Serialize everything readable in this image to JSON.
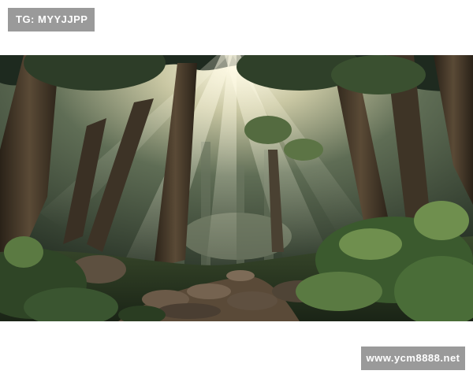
{
  "watermarks": {
    "top_left": "TG: MYYJJPP",
    "bottom_right": "www.ycm8888.net"
  },
  "scene": {
    "subject": "forest-path-with-sunbeams",
    "colors": {
      "canopy_dark": "#1e2a1f",
      "foliage": "#3d5a32",
      "fern": "#6f8f4e",
      "light": "#f4f0d6",
      "trunk": "#4a3a2a",
      "stone": "#6b5a48"
    }
  }
}
